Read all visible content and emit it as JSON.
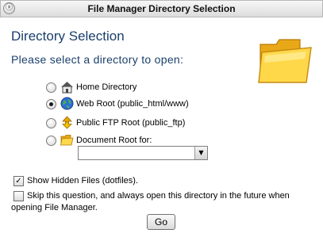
{
  "window": {
    "title": "File Manager Directory Selection",
    "close_glyph": "ⓧ"
  },
  "heading": "Directory Selection",
  "subheading": "Please select a directory to open:",
  "options": [
    {
      "label": "Home Directory",
      "icon": "home-icon",
      "selected": false
    },
    {
      "label": "Web Root (public_html/www)",
      "icon": "globe-icon",
      "selected": true
    },
    {
      "label": "Public FTP Root (public_ftp)",
      "icon": "ftp-icon",
      "selected": false
    },
    {
      "label": "Document Root for:",
      "icon": "folder-icon",
      "selected": false
    }
  ],
  "document_root_select": {
    "value": "",
    "arrow_glyph": "▼"
  },
  "show_hidden": {
    "label": "Show Hidden Files (dotfiles).",
    "checked": true,
    "check_glyph": "✓"
  },
  "skip_question": {
    "line1": "Skip this question, and always open this directory in the future when",
    "line2": "opening File Manager.",
    "checked": false
  },
  "go_button": "Go",
  "colors": {
    "heading": "#1a3f6b",
    "folder": "#f5c234"
  }
}
